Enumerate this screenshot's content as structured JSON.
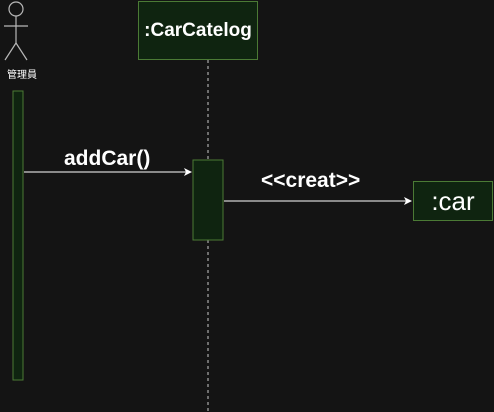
{
  "actor": {
    "label": "管理員",
    "icon": "stick-figure-icon"
  },
  "lifeline": {
    "label": ":CarCatelog"
  },
  "created_object": {
    "label": ":car"
  },
  "messages": [
    {
      "label": "addCar()",
      "from": "管理員",
      "to": ":CarCatelog"
    },
    {
      "label": "<<creat>>",
      "from": ":CarCatelog",
      "to": ":car"
    }
  ],
  "colors": {
    "background": "#141414",
    "box_fill": "#0f2410",
    "box_border": "#4b7a35",
    "line": "#ffffff",
    "dashed_line": "#c8c8c8",
    "text": "#ffffff"
  }
}
